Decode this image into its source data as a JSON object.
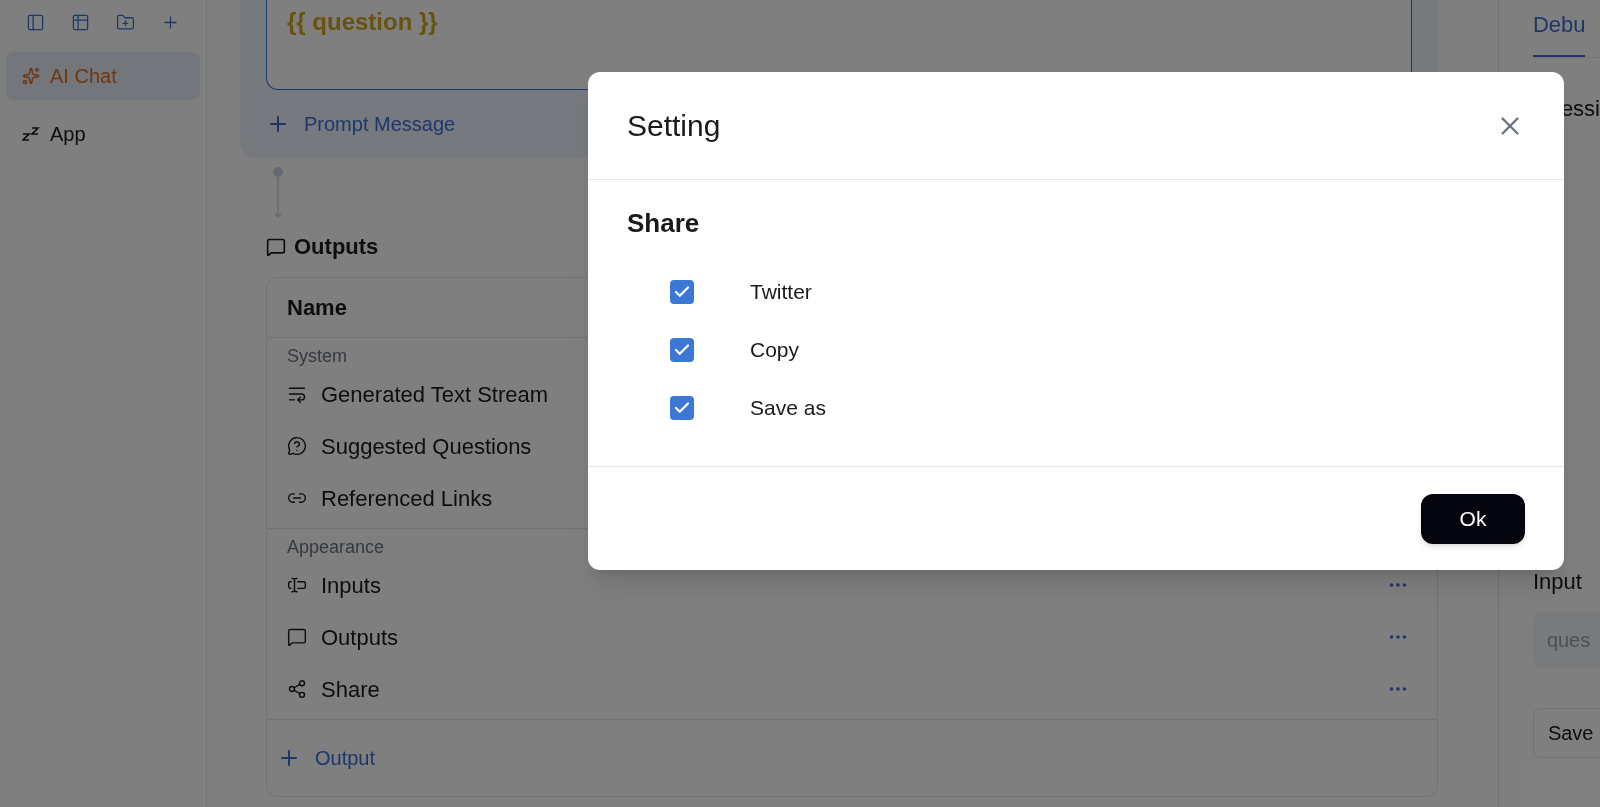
{
  "sidebar": {
    "items": [
      {
        "label": "AI Chat",
        "kind": "chat",
        "selected": true
      },
      {
        "label": "App",
        "kind": "app",
        "selected": false
      }
    ]
  },
  "prompt": {
    "text": "{{ question }}",
    "add_label": "Prompt Message"
  },
  "outputs": {
    "title": "Outputs",
    "column": "Name",
    "groups": [
      {
        "label": "System",
        "items": [
          {
            "label": "Generated Text Stream",
            "kind": "stream"
          },
          {
            "label": "Suggested Questions",
            "kind": "questions"
          },
          {
            "label": "Referenced Links",
            "kind": "links"
          }
        ]
      },
      {
        "label": "Appearance",
        "items": [
          {
            "label": "Inputs",
            "kind": "inputs",
            "menu": true
          },
          {
            "label": "Outputs",
            "kind": "outputs",
            "menu": true
          },
          {
            "label": "Share",
            "kind": "share",
            "menu": true
          }
        ]
      }
    ],
    "add_label": "Output"
  },
  "right_panel": {
    "tab": "Debu",
    "text": "essi",
    "section": "Input",
    "field_placeholder": "ques",
    "button": "Save"
  },
  "dialog": {
    "title": "Setting",
    "section": "Share",
    "options": [
      {
        "label": "Twitter",
        "checked": true
      },
      {
        "label": "Copy",
        "checked": true
      },
      {
        "label": "Save as",
        "checked": true
      }
    ],
    "button": "Ok"
  }
}
